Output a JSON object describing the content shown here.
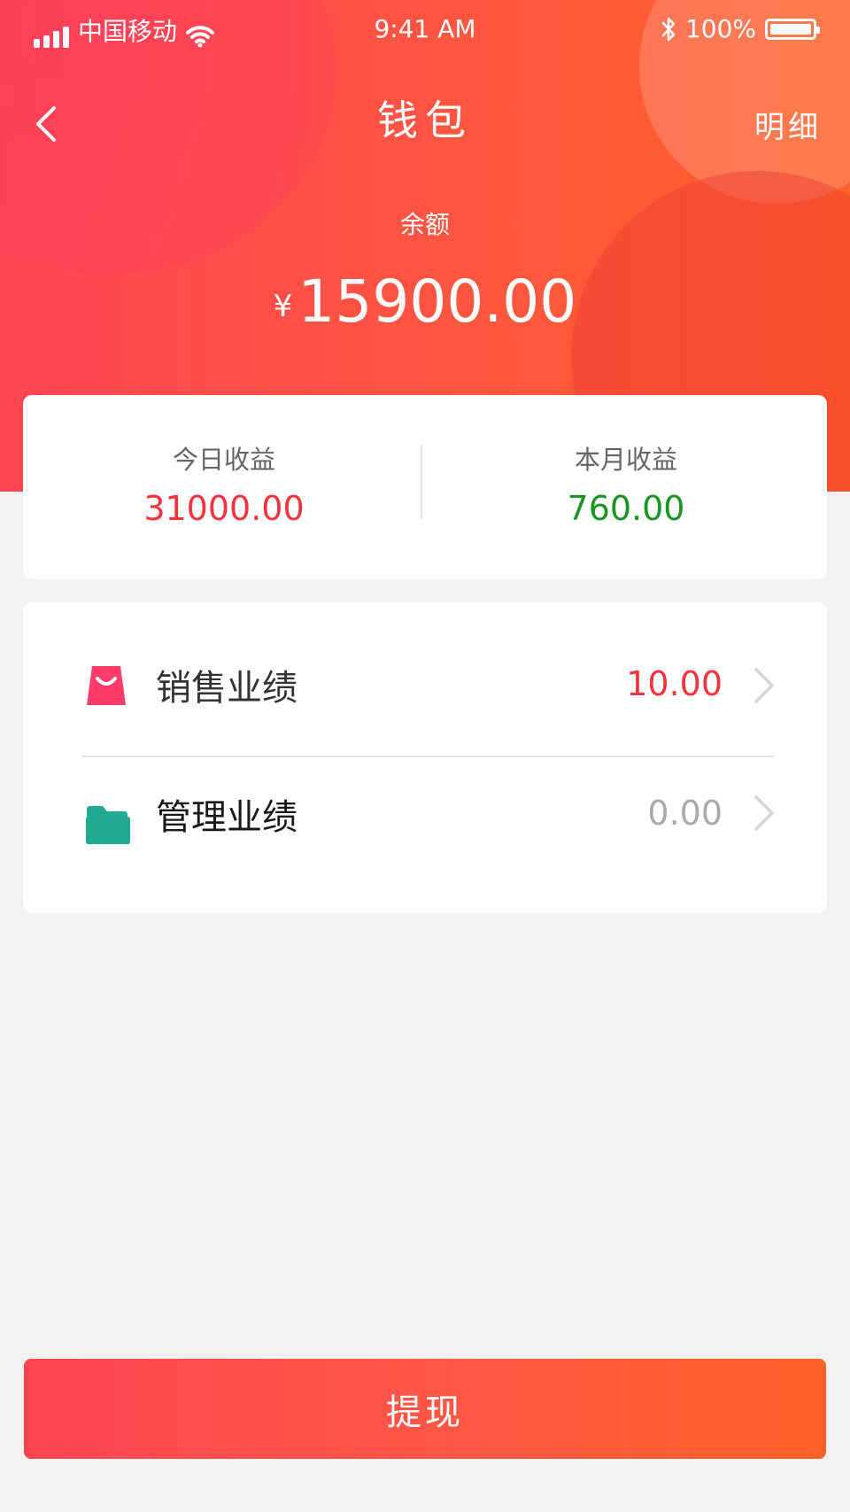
{
  "status_bar": {
    "carrier": "中国移动",
    "time": "9:41 AM",
    "battery": "100%"
  },
  "nav": {
    "title": "钱包",
    "detail_label": "明细"
  },
  "balance": {
    "label": "余额",
    "currency": "¥",
    "amount": "15900.00"
  },
  "income": {
    "today": {
      "label": "今日收益",
      "value": "31000.00",
      "color": "#f5333f"
    },
    "month": {
      "label": "本月收益",
      "value": "760.00",
      "color": "#1a9422"
    }
  },
  "performance": [
    {
      "label": "销售业绩",
      "value": "10.00",
      "icon": "shopping-bag-icon",
      "color": "#f5333f"
    },
    {
      "label": "管理业绩",
      "value": "0.00",
      "icon": "folder-icon",
      "color": "#aaaaaa"
    }
  ],
  "withdraw": {
    "label": "提现"
  },
  "colors": {
    "accent_start": "#ff4553",
    "accent_end": "#ff6128",
    "bag_icon": "#ff3c6a",
    "folder_icon": "#21a991"
  }
}
